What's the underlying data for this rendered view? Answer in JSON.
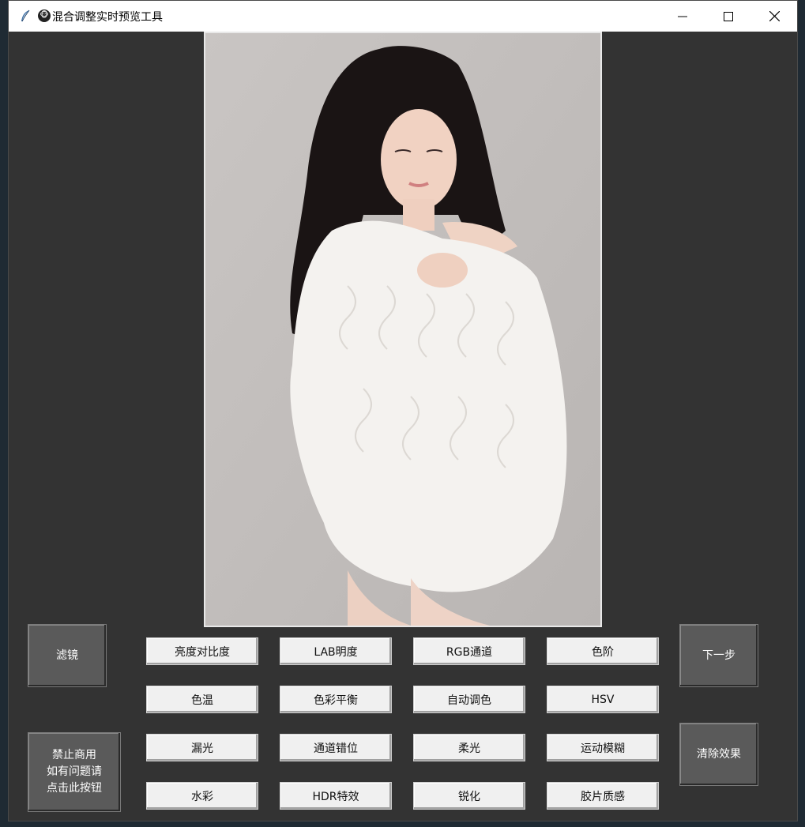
{
  "window": {
    "title": "混合调整实时预览工具",
    "title_emoji": "🐵"
  },
  "photo": {
    "description_icon": "portrait-photo"
  },
  "buttons": {
    "filter": "滤镜",
    "next_step": "下一步",
    "clear_effect": "清除效果",
    "notice_line1": "禁止商用",
    "notice_line2": "如有问题请",
    "notice_line3": "点击此按钮"
  },
  "adjustments": [
    [
      "亮度对比度",
      "LAB明度",
      "RGB通道",
      "色阶"
    ],
    [
      "色温",
      "色彩平衡",
      "自动调色",
      "HSV"
    ],
    [
      "漏光",
      "通道错位",
      "柔光",
      "运动模糊"
    ],
    [
      "水彩",
      "HDR特效",
      "锐化",
      "胶片质感"
    ]
  ],
  "colors": {
    "window_bg": "#333333",
    "titlebar_bg": "#ffffff",
    "big_button_bg": "#5a5a5a",
    "small_button_bg": "#f0f0f0"
  }
}
